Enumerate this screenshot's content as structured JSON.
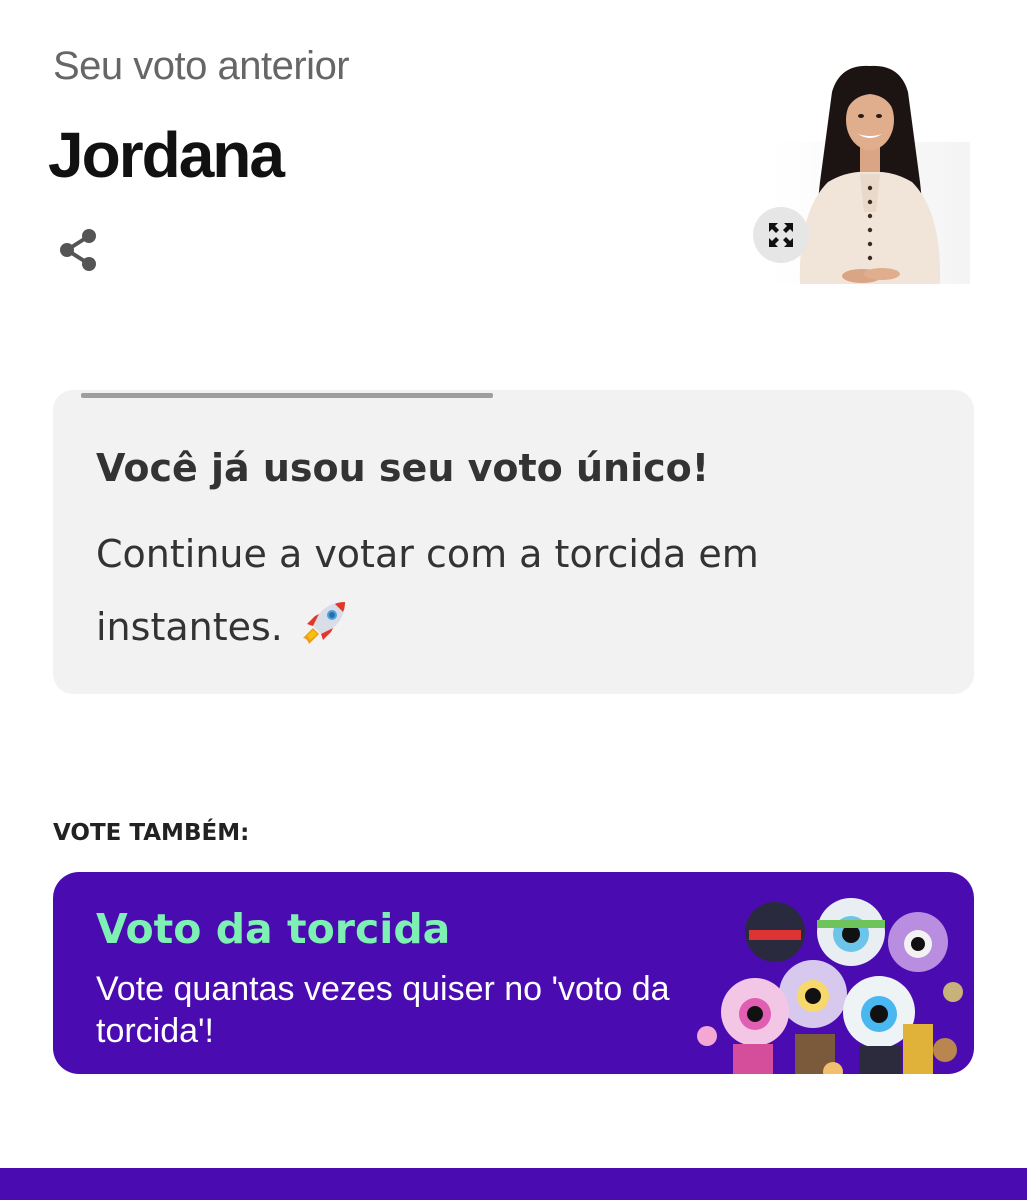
{
  "previous_vote": {
    "label": "Seu voto anterior",
    "candidate": "Jordana"
  },
  "icons": {
    "share": "share-icon",
    "expand": "expand-icon",
    "rocket": "rocket-emoji"
  },
  "notice": {
    "title": "Você já usou seu voto único!",
    "body": "Continue a votar com a torcida em instantes."
  },
  "vote_also": {
    "heading": "VOTE TAMBÉM:",
    "card_title": "Voto da torcida",
    "card_description": "Vote quantas vezes quiser no 'voto da torcida'!"
  },
  "colors": {
    "brand_purple": "#4a0cb0",
    "accent_green": "#7ff0b4",
    "card_grey": "#f2f2f2"
  }
}
